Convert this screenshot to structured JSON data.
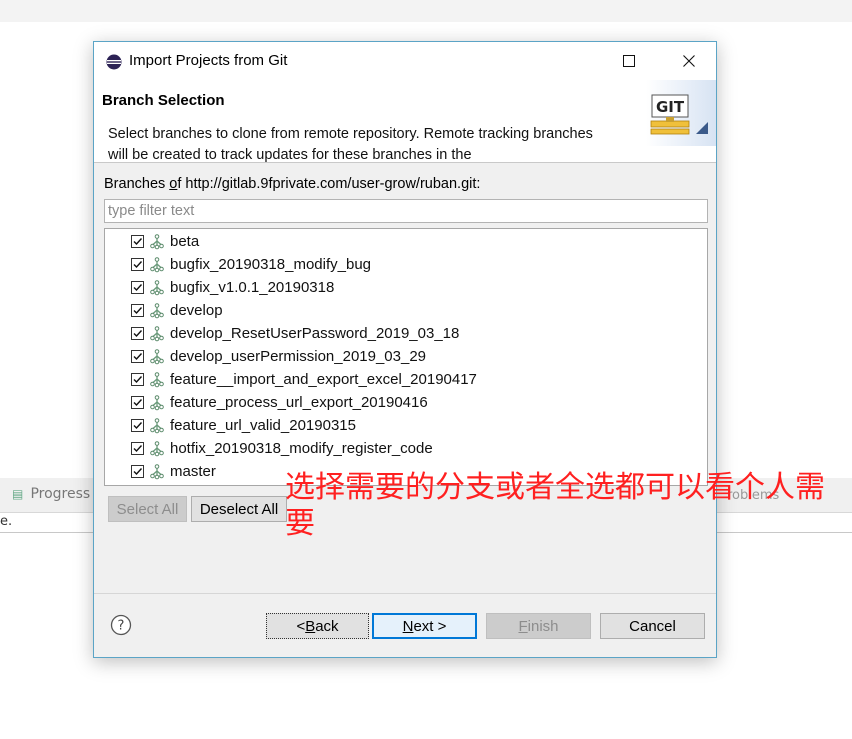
{
  "background": {
    "progress_tab": "Progress",
    "right_tab": "roblems",
    "stray_text": "e."
  },
  "dialog": {
    "title": "Import Projects from Git",
    "header": {
      "title": "Branch Selection",
      "description": "Select branches to clone from remote repository. Remote tracking branches will be created to track updates for these branches in the",
      "banner_text": "GIT"
    },
    "branches_label_prefix": "Branches ",
    "branches_label_mnemonic": "o",
    "branches_label_rest": "f http://gitlab.9fprivate.com/user-grow/ruban.git:",
    "filter": {
      "placeholder": "type filter text",
      "value": ""
    },
    "branches": [
      {
        "name": "beta",
        "checked": true
      },
      {
        "name": "bugfix_20190318_modify_bug",
        "checked": true
      },
      {
        "name": "bugfix_v1.0.1_20190318",
        "checked": true
      },
      {
        "name": "develop",
        "checked": true
      },
      {
        "name": "develop_ResetUserPassword_2019_03_18",
        "checked": true
      },
      {
        "name": "develop_userPermission_2019_03_29",
        "checked": true
      },
      {
        "name": "feature__import_and_export_excel_20190417",
        "checked": true
      },
      {
        "name": "feature_process_url_export_20190416",
        "checked": true
      },
      {
        "name": "feature_url_valid_20190315",
        "checked": true
      },
      {
        "name": "hotfix_20190318_modify_register_code",
        "checked": true
      },
      {
        "name": "master",
        "checked": true
      }
    ],
    "buttons": {
      "select_all": "Select All",
      "deselect_all": "Deselect All",
      "back_pre": "< ",
      "back_mn": "B",
      "back_post": "ack",
      "next_mn": "N",
      "next_post": "ext >",
      "finish_mn": "F",
      "finish_post": "inish",
      "cancel": "Cancel"
    }
  },
  "annotation": "选择需要的分支或者全选都可以看个人需要",
  "colors": {
    "dialog_border": "#5ba4c6",
    "annotation": "#ff2020",
    "next_border": "#0078d7"
  }
}
